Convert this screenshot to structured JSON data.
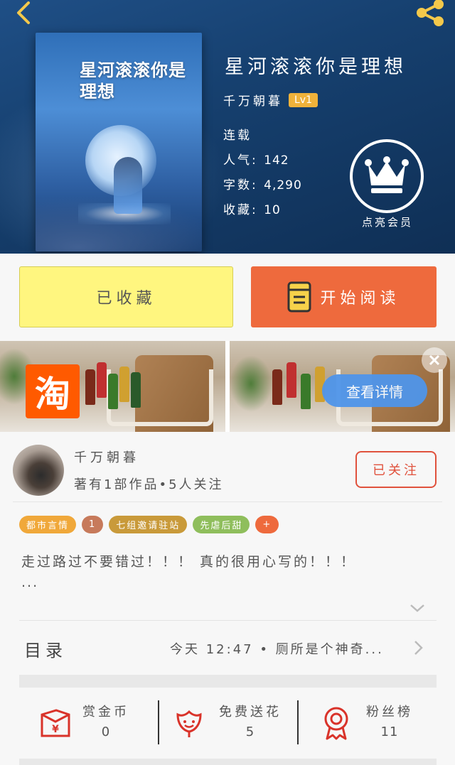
{
  "hero": {
    "cover_title": "星河滚滚你是理想",
    "title": "星河滚滚你是理想",
    "author": "千万朝暮",
    "level": "Lv1",
    "status": "连载",
    "popularity_label": "人气:",
    "popularity_value": "142",
    "words_label": "字数:",
    "words_value": "4,290",
    "collect_label": "收藏:",
    "collect_value": "10",
    "vip_label": "点亮会员"
  },
  "actions": {
    "collected_label": "已收藏",
    "read_label": "开始阅读"
  },
  "ad": {
    "taobao_glyph": "淘",
    "detail_label": "查看详情"
  },
  "author_card": {
    "name": "千万朝暮",
    "summary": "著有1部作品•5人关注",
    "follow_label": "已关注"
  },
  "tags": [
    {
      "label": "都市言情",
      "color": "#f0a83a"
    },
    {
      "label": "1",
      "color": "#c77a5b"
    },
    {
      "label": "七组邀请驻站",
      "color": "#c99a3a"
    },
    {
      "label": "先虐后甜",
      "color": "#8fbe5c"
    },
    {
      "label": "+",
      "color": "#ee6a3d"
    }
  ],
  "intro": {
    "text": "走过路过不要错过！！！ 真的很用心写的！！！",
    "more": "..."
  },
  "toc": {
    "label": "目录",
    "latest": "今天 12:47 • 厕所是个神奇..."
  },
  "stats": [
    {
      "label": "赏金币",
      "value": "0"
    },
    {
      "label": "免费送花",
      "value": "5"
    },
    {
      "label": "粉丝榜",
      "value": "11"
    }
  ],
  "colors": {
    "accent": "#ee6a3d",
    "follow": "#e0513c",
    "collected_bg": "#fff67f",
    "hero_bg": "#1a4677",
    "ad_button": "#4f95ea"
  }
}
